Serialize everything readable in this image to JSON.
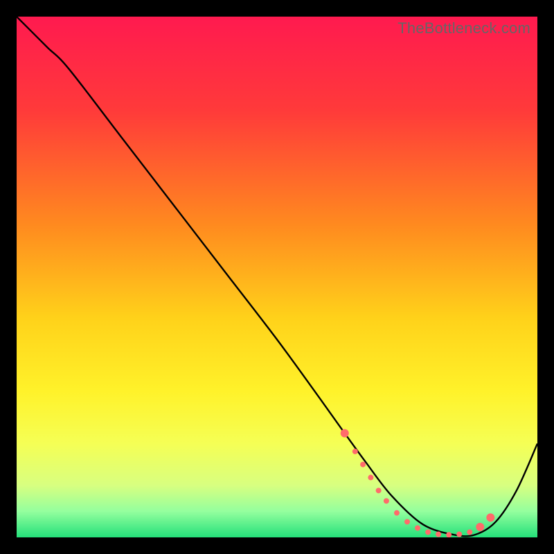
{
  "watermark": "TheBottleneck.com",
  "chart_data": {
    "type": "line",
    "title": "",
    "xlabel": "",
    "ylabel": "",
    "xlim": [
      0,
      100
    ],
    "ylim": [
      0,
      100
    ],
    "background_gradient": {
      "stops": [
        {
          "offset": 0,
          "color": "#ff1a4f"
        },
        {
          "offset": 18,
          "color": "#ff3a3a"
        },
        {
          "offset": 40,
          "color": "#ff8a1f"
        },
        {
          "offset": 58,
          "color": "#ffd21a"
        },
        {
          "offset": 72,
          "color": "#fff22a"
        },
        {
          "offset": 82,
          "color": "#f5ff55"
        },
        {
          "offset": 90,
          "color": "#d8ff80"
        },
        {
          "offset": 95,
          "color": "#94ff9e"
        },
        {
          "offset": 100,
          "color": "#24e07a"
        }
      ]
    },
    "series": [
      {
        "name": "curve",
        "color": "#000000",
        "x": [
          0,
          3,
          6,
          10,
          20,
          30,
          40,
          50,
          58,
          63,
          67,
          72,
          78,
          84,
          88,
          92,
          96,
          100
        ],
        "y": [
          100,
          97,
          94,
          90,
          77,
          64,
          51,
          38,
          27,
          20,
          14.5,
          8,
          2.5,
          0.5,
          0.5,
          3,
          9,
          18
        ]
      }
    ],
    "marker_cluster": {
      "name": "bottleneck-range",
      "color": "#ff6b6b",
      "radius_small": 4,
      "radius_large": 6,
      "points": [
        {
          "x": 63,
          "y": 20,
          "r": "large"
        },
        {
          "x": 65,
          "y": 16.5,
          "r": "small"
        },
        {
          "x": 66.5,
          "y": 14,
          "r": "small"
        },
        {
          "x": 68,
          "y": 11.5,
          "r": "small"
        },
        {
          "x": 69.5,
          "y": 9,
          "r": "small"
        },
        {
          "x": 71,
          "y": 7,
          "r": "small"
        },
        {
          "x": 73,
          "y": 4.7,
          "r": "small"
        },
        {
          "x": 75,
          "y": 3,
          "r": "small"
        },
        {
          "x": 77,
          "y": 1.8,
          "r": "small"
        },
        {
          "x": 79,
          "y": 1,
          "r": "small"
        },
        {
          "x": 81,
          "y": 0.6,
          "r": "small"
        },
        {
          "x": 83,
          "y": 0.5,
          "r": "small"
        },
        {
          "x": 85,
          "y": 0.6,
          "r": "small"
        },
        {
          "x": 87,
          "y": 1,
          "r": "small"
        },
        {
          "x": 89,
          "y": 2,
          "r": "large"
        },
        {
          "x": 91,
          "y": 3.8,
          "r": "large"
        }
      ]
    }
  }
}
